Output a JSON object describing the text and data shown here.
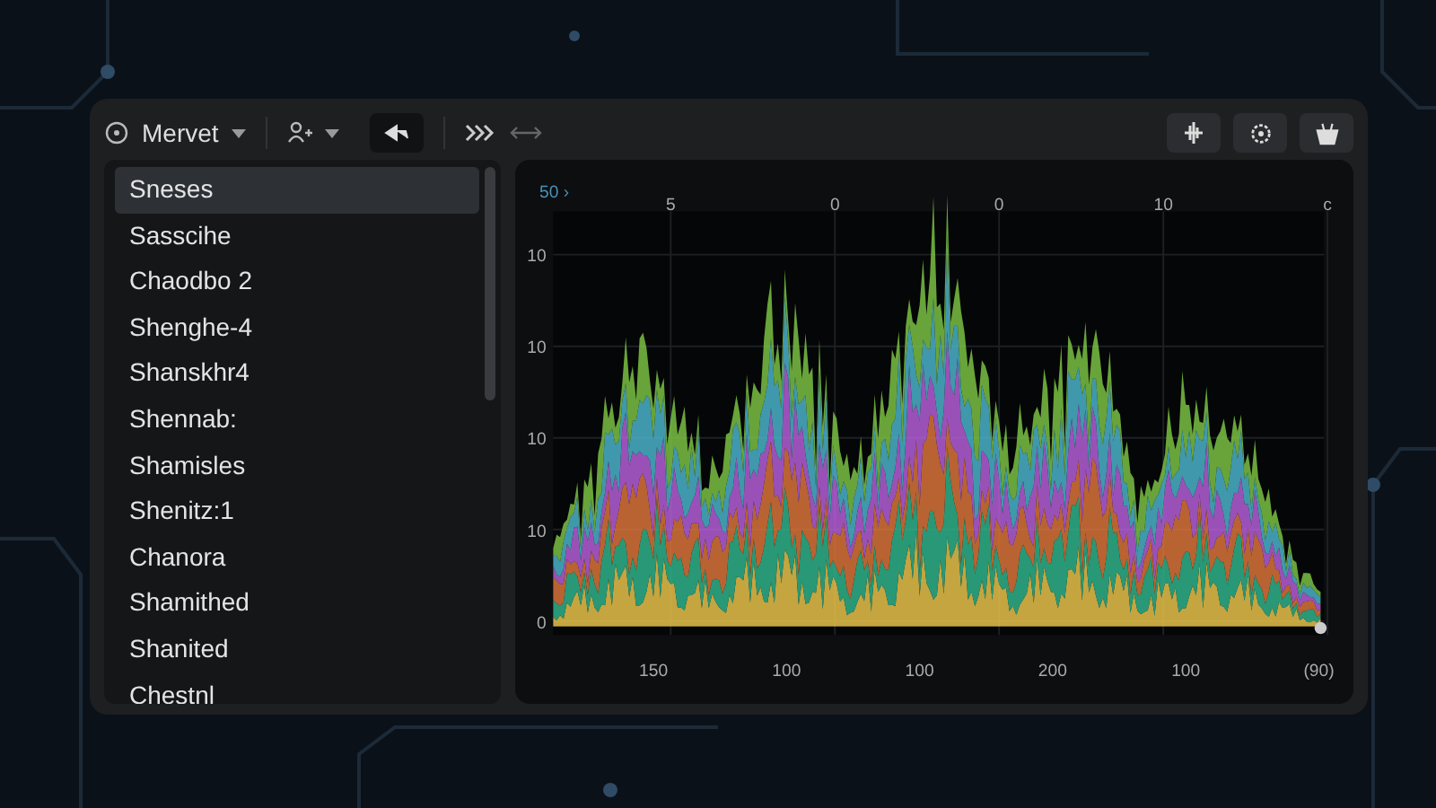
{
  "toolbar": {
    "title": "Mervet"
  },
  "sidebar": {
    "items": [
      {
        "label": "Sneses",
        "selected": true
      },
      {
        "label": "Sasscihe",
        "selected": false
      },
      {
        "label": "Chaodbo 2",
        "selected": false
      },
      {
        "label": "Shenghe-4",
        "selected": false
      },
      {
        "label": "Shanskhr4",
        "selected": false
      },
      {
        "label": "Shennab:",
        "selected": false
      },
      {
        "label": "Shamisles",
        "selected": false
      },
      {
        "label": "Shenitz:1",
        "selected": false
      },
      {
        "label": "Chanora",
        "selected": false
      },
      {
        "label": "Shamithed",
        "selected": false
      },
      {
        "label": "Shanited",
        "selected": false
      },
      {
        "label": "Chestnl",
        "selected": false
      }
    ]
  },
  "chart": {
    "corner_label": "50 ›",
    "top_labels": [
      "5",
      "0",
      "0",
      "10",
      "c"
    ],
    "left_labels": [
      "10",
      "10",
      "10",
      "10",
      "0"
    ],
    "bottom_labels": [
      "150",
      "100",
      "100",
      "200",
      "100",
      "(90)"
    ]
  }
}
